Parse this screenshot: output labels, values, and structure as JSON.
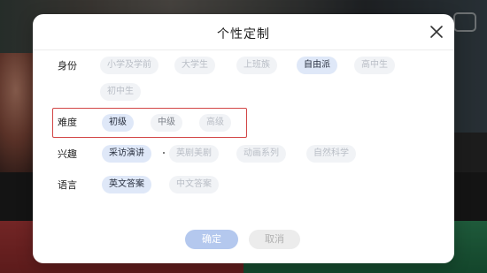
{
  "dialog": {
    "title": "个性定制",
    "confirm_label": "确定",
    "cancel_label": "取消"
  },
  "identity": {
    "label": "身份",
    "options": [
      "小学及学前",
      "大学生",
      "上班族",
      "自由派",
      "高中生",
      "初中生"
    ],
    "selected": "自由派"
  },
  "difficulty": {
    "label": "难度",
    "options": [
      "初级",
      "中级",
      "高级"
    ],
    "selected": "初级"
  },
  "interest": {
    "label": "兴趣",
    "options": [
      "采访演讲",
      "英剧美剧",
      "动画系列",
      "自然科学"
    ],
    "selected": "采访演讲"
  },
  "language": {
    "label": "语言",
    "options": [
      "英文答案",
      "中文答案"
    ],
    "selected": "英文答案"
  },
  "colors": {
    "selected_chip_bg": "#dfe8f8",
    "chip_bg": "#f1f3f6",
    "confirm_button": "#b4c8ee",
    "highlight_box": "#d24545",
    "background_red": "#b03a3a",
    "background_green": "#2f8a5a"
  }
}
